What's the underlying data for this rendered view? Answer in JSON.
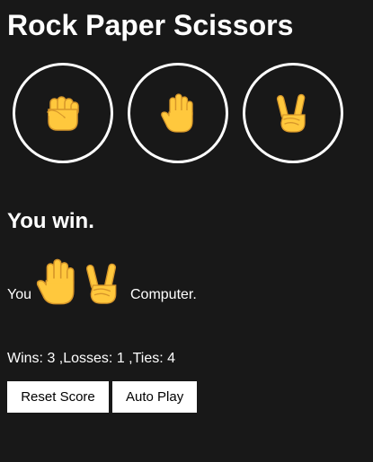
{
  "title": "Rock Paper Scissors",
  "moves": [
    {
      "name": "rock",
      "icon": "raised-fist-icon"
    },
    {
      "name": "paper",
      "icon": "raised-hand-icon"
    },
    {
      "name": "scissors",
      "icon": "victory-hand-icon"
    }
  ],
  "result": {
    "text": "You win.",
    "player_label": "You",
    "player_move_icon": "raised-hand-icon",
    "computer_move_icon": "victory-hand-icon",
    "computer_label": "Computer."
  },
  "score": {
    "text": "Wins: 3 ,Losses: 1 ,Ties: 4"
  },
  "controls": {
    "reset_label": "Reset Score",
    "auto_label": "Auto Play"
  },
  "colors": {
    "background": "#181818",
    "text": "#ffffff",
    "button_bg": "#ffffff",
    "button_text": "#000000",
    "emoji_fill": "#FFC83D",
    "emoji_outline": "#D6962A"
  }
}
